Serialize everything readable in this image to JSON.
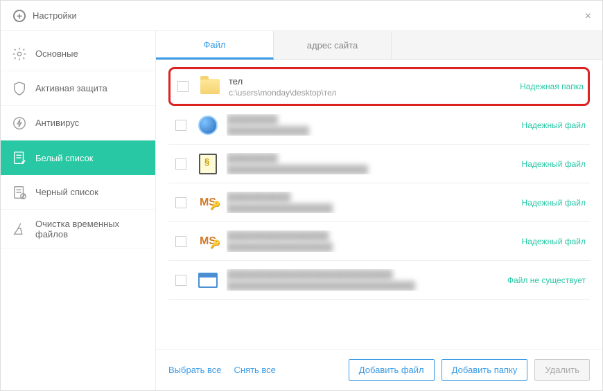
{
  "window": {
    "title": "Настройки"
  },
  "sidebar": [
    {
      "label": "Основные"
    },
    {
      "label": "Активная защита"
    },
    {
      "label": "Антивирус"
    },
    {
      "label": "Белый список",
      "active": true
    },
    {
      "label": "Черный список"
    },
    {
      "label": "Очистка временных файлов"
    }
  ],
  "tabs": [
    {
      "label": "Файл",
      "active": true
    },
    {
      "label": "адрес сайта"
    }
  ],
  "rows": [
    {
      "name": "тел",
      "path": "c:\\users\\monday\\desktop\\тел",
      "status": "Надежная папка",
      "icon": "folder",
      "highlighted": true
    },
    {
      "name": "",
      "path": "",
      "status": "Надежный файл",
      "icon": "orb",
      "blurred": true
    },
    {
      "name": "",
      "path": "",
      "status": "Надежный файл",
      "icon": "scroll",
      "blurred": true
    },
    {
      "name": "",
      "path": "",
      "status": "Надежный файл",
      "icon": "ms-key",
      "blurred": true
    },
    {
      "name": "",
      "path": "",
      "status": "Надежный файл",
      "icon": "ms-key",
      "blurred": true
    },
    {
      "name": "",
      "path": "",
      "status": "Файл не существует",
      "icon": "window",
      "blurred": true
    }
  ],
  "footer": {
    "select_all": "Выбрать все",
    "deselect_all": "Снять все",
    "add_file": "Добавить файл",
    "add_folder": "Добавить папку",
    "delete": "Удалить"
  },
  "colors": {
    "accent": "#28c8a5",
    "link": "#3a9be6",
    "highlight_border": "#d22"
  }
}
